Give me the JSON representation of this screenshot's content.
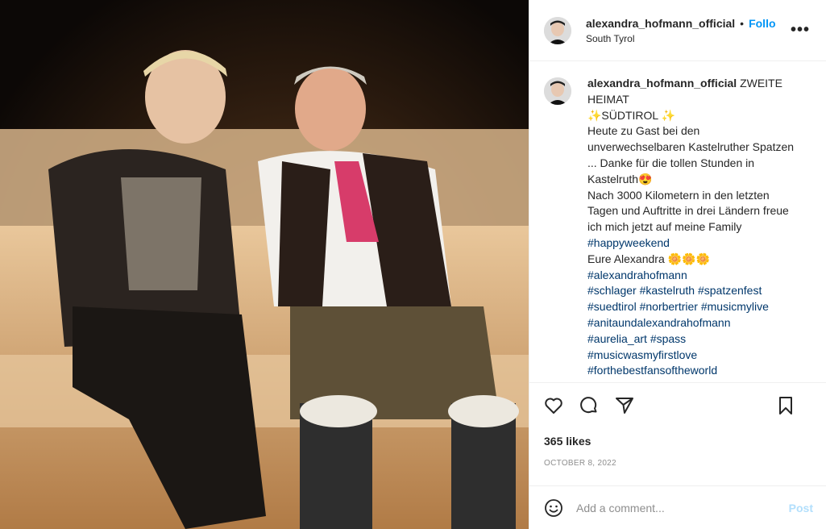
{
  "post": {
    "username": "alexandra_hofmann_official",
    "follow_label": "Follo",
    "separator": "•",
    "location": "South Tyrol",
    "more_icon": "more-icon",
    "caption": {
      "username": "alexandra_hofmann_official",
      "lines": [
        "ZWEITE HEIMAT",
        "✨SÜDTIROL ✨",
        "Heute zu Gast bei den unverwechselbaren Kastelruther Spatzen ... Danke für die tollen Stunden in Kastelruth😍",
        "Nach 3000 Kilometern in den letzten Tagen und Auftritte in drei Ländern freue ich mich jetzt auf meine Family",
        "#happyweekend",
        "Eure Alexandra 🌼🌼🌼",
        "#alexandrahofmann",
        "#schlager #kastelruth #spatzenfest",
        "#suedtirol #norbertrier #musicmylive",
        "#anitaundalexandrahofmann",
        "#aurelia_art #spass",
        "#musicwasmyfirstlove",
        "#forthebestfansoftheworld"
      ]
    },
    "likes": "365 likes",
    "date": "OCTOBER 8, 2022",
    "comment_placeholder": "Add a comment...",
    "post_label": "Post",
    "colors": {
      "accent": "#0095f6",
      "hashtag": "#00376b",
      "post_disabled": "#b2dffc",
      "muted": "#8e8e8e"
    }
  }
}
